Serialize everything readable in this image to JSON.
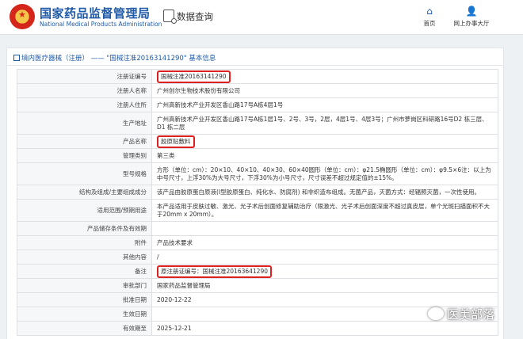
{
  "header": {
    "title": "国家药品监督管理局",
    "subtitle": "National Medical Products Administration",
    "query_label": "数据查询",
    "nav_home": "首页",
    "nav_hall": "网上办事大厅",
    "emblem_icon": "national-emblem",
    "accent": "#1f5aa8"
  },
  "panel": {
    "heading": "境内医疗器械（注册） —— \"国械注准20163141290\" 基本信息"
  },
  "rows": [
    {
      "label": "注册证编号",
      "value": "国械注准20163141290",
      "highlight": true,
      "h": 18
    },
    {
      "label": "注册人名称",
      "value": "广州创尔生物技术股份有限公司",
      "highlight": false,
      "h": 18
    },
    {
      "label": "注册人住所",
      "value": "广州高新技术产业开发区香山路17号A栋4层1号",
      "highlight": false,
      "h": 18
    },
    {
      "label": "生产地址",
      "value": "广州高新技术产业开发区香山路17号A栋1层1号、2号、3号，2层，4层1号、4层3号；广州市萝岗区科研路16号D2 栋三层、D1 栋二层",
      "highlight": false,
      "h": 28
    },
    {
      "label": "产品名称",
      "value": "胶原贴敷料",
      "highlight": true,
      "h": 18
    },
    {
      "label": "管理类别",
      "value": "第三类",
      "highlight": false,
      "h": 18
    },
    {
      "label": "型号规格",
      "value": "方形（单位：cm）：20×10、40×10、40×30、60×40圆形（单位：cm）：φ21.5椭圆形（单位：cm）：φ9.5×6注：以上为中号尺寸，上浮30%为大号尺寸，下浮30%为小号尺寸，尺寸误差不超过规定值的±15%。",
      "highlight": false,
      "h": 28
    },
    {
      "label": "结构及组成/主要组成成分",
      "value": "该产品由胶原蛋白原液(I型胶原蛋白、纯化水、防腐剂) 和非织造布组成。无菌产品，灭菌方式：经辐照灭菌，一次性使用。",
      "highlight": false,
      "h": 18
    },
    {
      "label": "适用范围/预期用途",
      "value": "本产品适用于皮肤过敏、激光、光子术后创面修复辅助治疗（限激光、光子术后创面深度不超过真皮层，单个光斑扫描面积不大于20mm x 20mm）。",
      "highlight": false,
      "h": 28
    },
    {
      "label": "产品储存条件及有效期",
      "value": "",
      "highlight": false,
      "h": 18
    },
    {
      "label": "附件",
      "value": "产品技术要求",
      "highlight": false,
      "h": 18
    },
    {
      "label": "其他内容",
      "value": "/",
      "highlight": false,
      "h": 18
    },
    {
      "label": "备注",
      "value": "原注册证编号：国械注准20163641290",
      "highlight": true,
      "h": 18
    },
    {
      "label": "审批部门",
      "value": "国家药品监督管理局",
      "highlight": false,
      "h": 18
    },
    {
      "label": "批准日期",
      "value": "2020-12-22",
      "highlight": false,
      "h": 18
    },
    {
      "label": "生效日期",
      "value": "",
      "highlight": false,
      "h": 18
    },
    {
      "label": "有效期至",
      "value": "2025-12-21",
      "highlight": false,
      "h": 18
    }
  ],
  "watermark": {
    "text": "医美部落",
    "icon": "wechat-icon"
  },
  "colors": {
    "highlight_border": "#e02020",
    "label_bg": "#f6f7f9"
  }
}
